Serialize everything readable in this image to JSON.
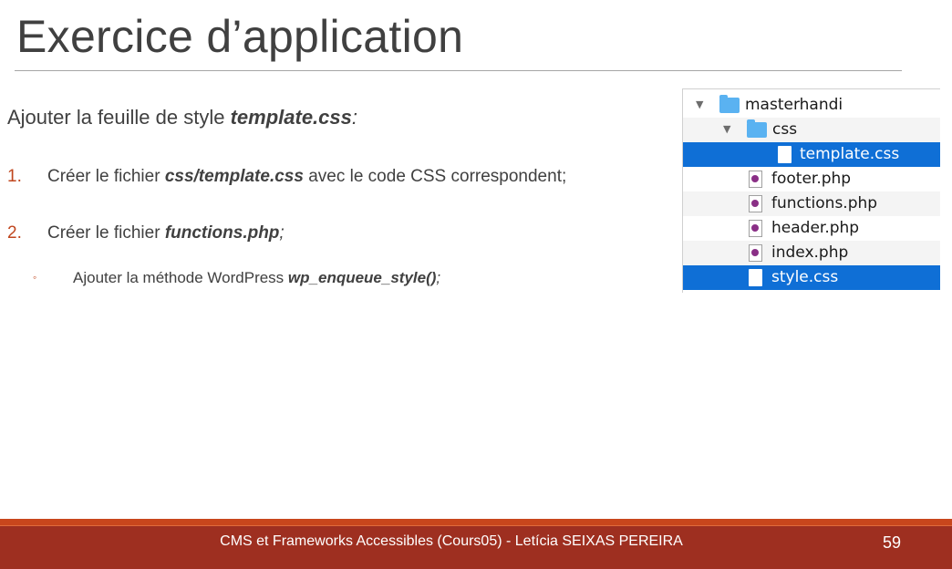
{
  "slide": {
    "title": "Exercice d’application",
    "intro": {
      "prefix": "Ajouter la feuille de style ",
      "filename": "template.css",
      "suffix": ":"
    },
    "items": [
      {
        "number": "1.",
        "prefix": "Créer le fichier ",
        "filename": "css/template.css",
        "suffix": " avec le code CSS correspondent;"
      },
      {
        "number": "2.",
        "prefix": "Créer le fichier ",
        "filename": "functions.php",
        "suffix": ";"
      }
    ],
    "subitem": {
      "bullet": "◦",
      "prefix": "Ajouter la méthode WordPress ",
      "method": "wp_enqueue_style()",
      "suffix": ";"
    }
  },
  "file_tree": {
    "rows": [
      {
        "label": "masterhandi",
        "type": "folder",
        "expanded": true
      },
      {
        "label": "css",
        "type": "folder",
        "expanded": true
      },
      {
        "label": "template.css",
        "type": "css-file",
        "selected": true
      },
      {
        "label": "footer.php",
        "type": "php-file"
      },
      {
        "label": "functions.php",
        "type": "php-file"
      },
      {
        "label": "header.php",
        "type": "php-file"
      },
      {
        "label": "index.php",
        "type": "php-file"
      },
      {
        "label": "style.css",
        "type": "css-file",
        "selected": true
      }
    ],
    "disclosure_glyph": "▼"
  },
  "footer": {
    "text": "CMS et Frameworks Accessibles (Cours05) - Letícia SEIXAS PEREIRA",
    "page_number": "59"
  },
  "colors": {
    "accent": "#c0461e",
    "footer_bg": "#9e2f20",
    "selection": "#0f6fd6",
    "folder": "#5ab2f1"
  }
}
